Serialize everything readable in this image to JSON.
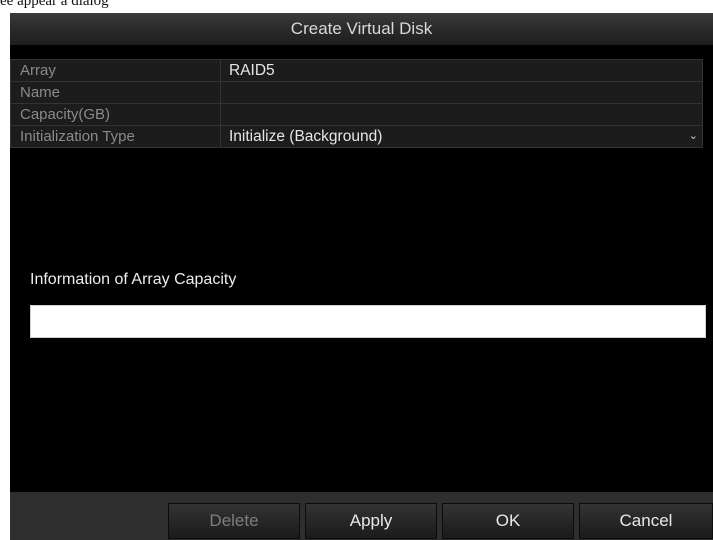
{
  "page_caption_fragment": "ee appear a dialog",
  "dialog": {
    "title": "Create Virtual Disk",
    "fields": [
      {
        "label": "Array",
        "value": "RAID5"
      },
      {
        "label": "Name",
        "value": ""
      },
      {
        "label": "Capacity(GB)",
        "value": ""
      },
      {
        "label": "Initialization Type",
        "value": "Initialize (Background)",
        "dropdown_icon": "chevron-down-icon"
      }
    ],
    "capacity_section": {
      "label": "Information of Array Capacity",
      "bar_value": ""
    },
    "buttons": [
      {
        "label": "Delete",
        "enabled": false
      },
      {
        "label": "Apply",
        "enabled": true
      },
      {
        "label": "OK",
        "enabled": true
      },
      {
        "label": "Cancel",
        "enabled": true
      }
    ]
  }
}
